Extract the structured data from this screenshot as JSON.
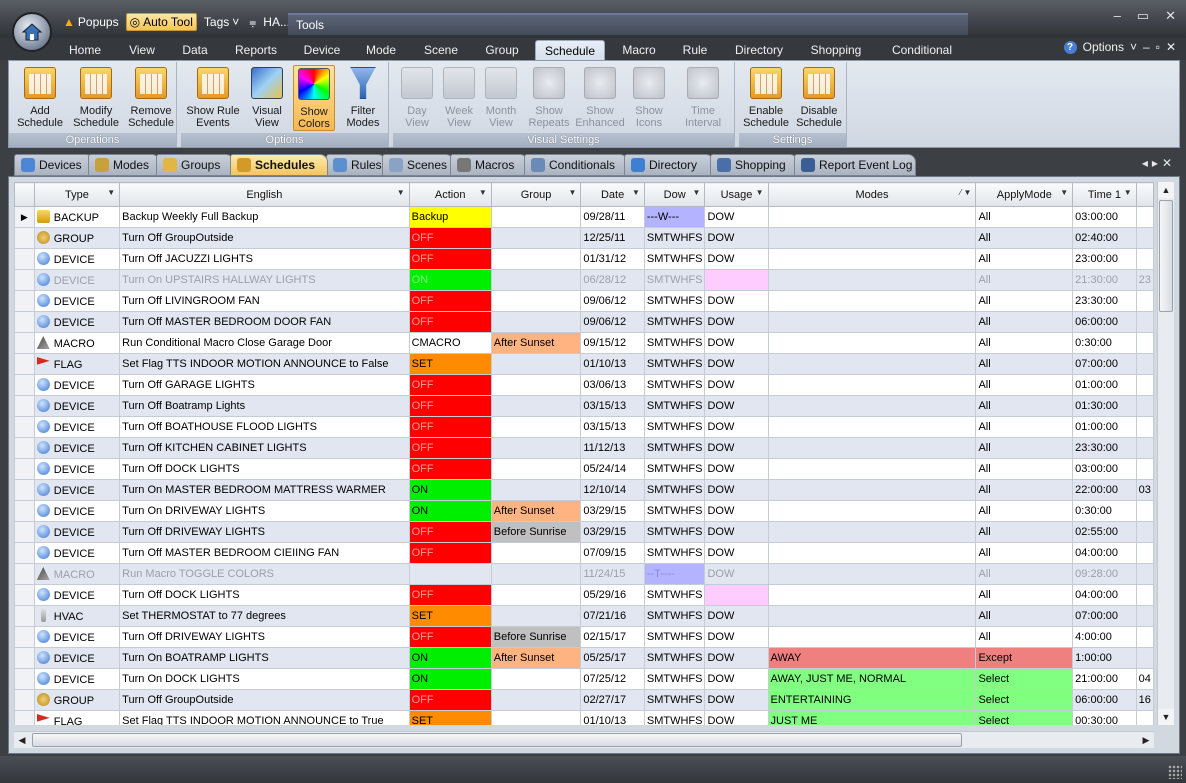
{
  "qat": {
    "popups": "Popups",
    "auto_tool": "Auto Tool",
    "tags": "Tags",
    "app_title": "HA..."
  },
  "context_tab": "Tools",
  "window_controls": {
    "minimize": "–",
    "restore": "▭",
    "close": "✕"
  },
  "ribbon_tabs": [
    "Home",
    "View",
    "Data",
    "Reports",
    "Device",
    "Mode",
    "Scene",
    "Group",
    "Schedule",
    "Macro",
    "Rule",
    "Directory",
    "Shopping",
    "Conditional"
  ],
  "active_ribbon_tab": "Schedule",
  "options_label": "Options",
  "ribbon": {
    "operations": {
      "label": "Operations",
      "add": "Add Schedule",
      "modify": "Modify Schedule",
      "remove": "Remove Schedule"
    },
    "options": {
      "label": "Options",
      "show_rule_events": "Show Rule Events",
      "visual_view": "Visual View",
      "show_colors": "Show Colors",
      "filter_modes": "Filter Modes"
    },
    "visual_settings": {
      "label": "Visual Settings",
      "day_view": "Day View",
      "week_view": "Week View",
      "month_view": "Month View",
      "show_repeats": "Show Repeats",
      "show_enhanced": "Show Enhanced",
      "show_icons": "Show Icons",
      "time_interval": "Time Interval"
    },
    "settings": {
      "label": "Settings",
      "enable": "Enable Schedule",
      "disable": "Disable Schedule"
    }
  },
  "doc_tabs": [
    "Devices",
    "Modes",
    "Groups",
    "Schedules",
    "Rules",
    "Scenes",
    "Macros",
    "Conditionals",
    "Directory",
    "Shopping",
    "Report Event Log"
  ],
  "active_doc_tab": "Schedules",
  "columns": [
    "Type",
    "English",
    "Action",
    "Group",
    "Date",
    "Dow",
    "Usage",
    "Modes",
    "ApplyMode",
    "Time 1"
  ],
  "rows": [
    {
      "type": "BACKUP",
      "icon": "backup-icon",
      "english": "Backup Weekly Full Backup",
      "action": "Backup",
      "action_color": "yellow",
      "group": "",
      "group_color": "",
      "date": "09/28/11",
      "dow": "---W---",
      "dow_color": "lavender",
      "usage": "DOW",
      "usage_color": "",
      "modes": "",
      "modes_color": "",
      "apply": "All",
      "apply_color": "",
      "time1": "03:00:00",
      "extra": "",
      "dim": false,
      "current": true
    },
    {
      "type": "GROUP",
      "icon": "group-icon",
      "english": "Turn Off GroupOutside",
      "action": "OFF",
      "action_color": "red",
      "group": "",
      "group_color": "",
      "date": "12/25/11",
      "dow": "SMTWHFS",
      "dow_color": "",
      "usage": "DOW",
      "usage_color": "",
      "modes": "",
      "modes_color": "",
      "apply": "All",
      "apply_color": "",
      "time1": "02:40:00",
      "extra": "",
      "dim": false,
      "current": false
    },
    {
      "type": "DEVICE",
      "icon": "device-icon",
      "english": "Turn Off JACUZZI LIGHTS",
      "action": "OFF",
      "action_color": "red",
      "group": "",
      "group_color": "",
      "date": "01/31/12",
      "dow": "SMTWHFS",
      "dow_color": "",
      "usage": "DOW",
      "usage_color": "",
      "modes": "",
      "modes_color": "",
      "apply": "All",
      "apply_color": "",
      "time1": "23:00:00",
      "extra": "",
      "dim": false,
      "current": false
    },
    {
      "type": "DEVICE",
      "icon": "device-icon",
      "english": "Turn On UPSTAIRS HALLWAY LIGHTS",
      "action": "ON",
      "action_color": "green",
      "group": "",
      "group_color": "",
      "date": "06/28/12",
      "dow": "SMTWHFS",
      "dow_color": "",
      "usage": "",
      "usage_color": "pink",
      "modes": "",
      "modes_color": "",
      "apply": "All",
      "apply_color": "",
      "time1": "21:30:00",
      "extra": "23",
      "dim": true,
      "current": false
    },
    {
      "type": "DEVICE",
      "icon": "device-icon",
      "english": "Turn Off LIVINGROOM FAN",
      "action": "OFF",
      "action_color": "red",
      "group": "",
      "group_color": "",
      "date": "09/06/12",
      "dow": "SMTWHFS",
      "dow_color": "",
      "usage": "DOW",
      "usage_color": "",
      "modes": "",
      "modes_color": "",
      "apply": "All",
      "apply_color": "",
      "time1": "23:30:00",
      "extra": "",
      "dim": false,
      "current": false
    },
    {
      "type": "DEVICE",
      "icon": "device-icon",
      "english": "Turn Off MASTER BEDROOM DOOR FAN",
      "action": "OFF",
      "action_color": "red",
      "group": "",
      "group_color": "",
      "date": "09/06/12",
      "dow": "SMTWHFS",
      "dow_color": "",
      "usage": "DOW",
      "usage_color": "",
      "modes": "",
      "modes_color": "",
      "apply": "All",
      "apply_color": "",
      "time1": "06:00:00",
      "extra": "",
      "dim": false,
      "current": false
    },
    {
      "type": "MACRO",
      "icon": "macro-icon",
      "english": "Run Conditional Macro Close Garage Door",
      "action": "CMACRO",
      "action_color": "",
      "group": "After Sunset",
      "group_color": "peach",
      "date": "09/15/12",
      "dow": "SMTWHFS",
      "dow_color": "",
      "usage": "DOW",
      "usage_color": "",
      "modes": "",
      "modes_color": "",
      "apply": "All",
      "apply_color": "",
      "time1": "0:30:00",
      "extra": "",
      "dim": false,
      "current": false
    },
    {
      "type": "FLAG",
      "icon": "flag-icon",
      "english": "Set Flag TTS INDOOR MOTION ANNOUNCE to False",
      "action": "SET",
      "action_color": "orange",
      "group": "",
      "group_color": "",
      "date": "01/10/13",
      "dow": "SMTWHFS",
      "dow_color": "",
      "usage": "DOW",
      "usage_color": "",
      "modes": "",
      "modes_color": "",
      "apply": "All",
      "apply_color": "",
      "time1": "07:00:00",
      "extra": "",
      "dim": false,
      "current": false
    },
    {
      "type": "DEVICE",
      "icon": "device-icon",
      "english": "Turn Off GARAGE LIGHTS",
      "action": "OFF",
      "action_color": "red",
      "group": "",
      "group_color": "",
      "date": "03/06/13",
      "dow": "SMTWHFS",
      "dow_color": "",
      "usage": "DOW",
      "usage_color": "",
      "modes": "",
      "modes_color": "",
      "apply": "All",
      "apply_color": "",
      "time1": "01:00:00",
      "extra": "",
      "dim": false,
      "current": false
    },
    {
      "type": "DEVICE",
      "icon": "device-icon",
      "english": "Turn Off Boatramp Lights",
      "action": "OFF",
      "action_color": "red",
      "group": "",
      "group_color": "",
      "date": "03/15/13",
      "dow": "SMTWHFS",
      "dow_color": "",
      "usage": "DOW",
      "usage_color": "",
      "modes": "",
      "modes_color": "",
      "apply": "All",
      "apply_color": "",
      "time1": "01:30:00",
      "extra": "",
      "dim": false,
      "current": false
    },
    {
      "type": "DEVICE",
      "icon": "device-icon",
      "english": "Turn Off BOATHOUSE FLOOD LIGHTS",
      "action": "OFF",
      "action_color": "red",
      "group": "",
      "group_color": "",
      "date": "03/15/13",
      "dow": "SMTWHFS",
      "dow_color": "",
      "usage": "DOW",
      "usage_color": "",
      "modes": "",
      "modes_color": "",
      "apply": "All",
      "apply_color": "",
      "time1": "01:00:00",
      "extra": "",
      "dim": false,
      "current": false
    },
    {
      "type": "DEVICE",
      "icon": "device-icon",
      "english": "Turn Off KITCHEN CABINET LIGHTS",
      "action": "OFF",
      "action_color": "red",
      "group": "",
      "group_color": "",
      "date": "11/12/13",
      "dow": "SMTWHFS",
      "dow_color": "",
      "usage": "DOW",
      "usage_color": "",
      "modes": "",
      "modes_color": "",
      "apply": "All",
      "apply_color": "",
      "time1": "23:30:00",
      "extra": "",
      "dim": false,
      "current": false
    },
    {
      "type": "DEVICE",
      "icon": "device-icon",
      "english": "Turn Off DOCK LIGHTS",
      "action": "OFF",
      "action_color": "red",
      "group": "",
      "group_color": "",
      "date": "05/24/14",
      "dow": "SMTWHFS",
      "dow_color": "",
      "usage": "DOW",
      "usage_color": "",
      "modes": "",
      "modes_color": "",
      "apply": "All",
      "apply_color": "",
      "time1": "03:00:00",
      "extra": "",
      "dim": false,
      "current": false
    },
    {
      "type": "DEVICE",
      "icon": "device-icon",
      "english": "Turn On MASTER BEDROOM MATTRESS WARMER",
      "action": "ON",
      "action_color": "green",
      "group": "",
      "group_color": "",
      "date": "12/10/14",
      "dow": "SMTWHFS",
      "dow_color": "",
      "usage": "DOW",
      "usage_color": "",
      "modes": "",
      "modes_color": "",
      "apply": "All",
      "apply_color": "",
      "time1": "22:00:00",
      "extra": "03",
      "dim": false,
      "current": false
    },
    {
      "type": "DEVICE",
      "icon": "device-icon",
      "english": "Turn On DRIVEWAY LIGHTS",
      "action": "ON",
      "action_color": "green",
      "group": "After Sunset",
      "group_color": "peach",
      "date": "03/29/15",
      "dow": "SMTWHFS",
      "dow_color": "",
      "usage": "DOW",
      "usage_color": "",
      "modes": "",
      "modes_color": "",
      "apply": "All",
      "apply_color": "",
      "time1": "0:30:00",
      "extra": "",
      "dim": false,
      "current": false
    },
    {
      "type": "DEVICE",
      "icon": "device-icon",
      "english": "Turn Off DRIVEWAY LIGHTS",
      "action": "OFF",
      "action_color": "red",
      "group": "Before Sunrise",
      "group_color": "lightgray",
      "date": "03/29/15",
      "dow": "SMTWHFS",
      "dow_color": "",
      "usage": "DOW",
      "usage_color": "",
      "modes": "",
      "modes_color": "",
      "apply": "All",
      "apply_color": "",
      "time1": "02:55:00",
      "extra": "",
      "dim": false,
      "current": false
    },
    {
      "type": "DEVICE",
      "icon": "device-icon",
      "english": "Turn Off MASTER BEDROOM CIEIING FAN",
      "action": "OFF",
      "action_color": "red",
      "group": "",
      "group_color": "",
      "date": "07/09/15",
      "dow": "SMTWHFS",
      "dow_color": "",
      "usage": "DOW",
      "usage_color": "",
      "modes": "",
      "modes_color": "",
      "apply": "All",
      "apply_color": "",
      "time1": "04:00:00",
      "extra": "",
      "dim": false,
      "current": false
    },
    {
      "type": "MACRO",
      "icon": "macro-icon",
      "english": "Run Macro TOGGLE COLORS",
      "action": "",
      "action_color": "",
      "group": "",
      "group_color": "",
      "date": "11/24/15",
      "dow": "--T----",
      "dow_color": "lavender",
      "usage": "DOW",
      "usage_color": "",
      "modes": "",
      "modes_color": "",
      "apply": "All",
      "apply_color": "",
      "time1": "09:28:00",
      "extra": "",
      "dim": true,
      "current": false
    },
    {
      "type": "DEVICE",
      "icon": "device-icon",
      "english": "Turn Off DOCK LIGHTS",
      "action": "OFF",
      "action_color": "red",
      "group": "",
      "group_color": "",
      "date": "05/29/16",
      "dow": "SMTWHFS",
      "dow_color": "",
      "usage": "",
      "usage_color": "pink",
      "modes": "",
      "modes_color": "",
      "apply": "All",
      "apply_color": "",
      "time1": "04:00:00",
      "extra": "",
      "dim": false,
      "current": false
    },
    {
      "type": "HVAC",
      "icon": "hvac-icon",
      "english": "Set THERMOSTAT to 77 degrees",
      "action": "SET",
      "action_color": "orange",
      "group": "",
      "group_color": "",
      "date": "07/21/16",
      "dow": "SMTWHFS",
      "dow_color": "",
      "usage": "DOW",
      "usage_color": "",
      "modes": "",
      "modes_color": "",
      "apply": "All",
      "apply_color": "",
      "time1": "07:00:00",
      "extra": "",
      "dim": false,
      "current": false
    },
    {
      "type": "DEVICE",
      "icon": "device-icon",
      "english": "Turn Off DRIVEWAY LIGHTS",
      "action": "OFF",
      "action_color": "red",
      "group": "Before Sunrise",
      "group_color": "lightgray",
      "date": "02/15/17",
      "dow": "SMTWHFS",
      "dow_color": "",
      "usage": "DOW",
      "usage_color": "",
      "modes": "",
      "modes_color": "",
      "apply": "All",
      "apply_color": "",
      "time1": "4:00:00",
      "extra": "",
      "dim": false,
      "current": false
    },
    {
      "type": "DEVICE",
      "icon": "device-icon",
      "english": "Turn On BOATRAMP LIGHTS",
      "action": "ON",
      "action_color": "green",
      "group": "After Sunset",
      "group_color": "peach",
      "date": "05/25/17",
      "dow": "SMTWHFS",
      "dow_color": "",
      "usage": "DOW",
      "usage_color": "",
      "modes": "AWAY",
      "modes_color": "salmon",
      "apply": "Except",
      "apply_color": "salmon",
      "time1": "1:00:00",
      "extra": "",
      "dim": false,
      "current": false
    },
    {
      "type": "DEVICE",
      "icon": "device-icon",
      "english": "Turn On DOCK LIGHTS",
      "action": "ON",
      "action_color": "green",
      "group": "",
      "group_color": "",
      "date": "07/25/12",
      "dow": "SMTWHFS",
      "dow_color": "",
      "usage": "DOW",
      "usage_color": "",
      "modes": "AWAY, JUST ME, NORMAL",
      "modes_color": "lightgreen",
      "apply": "Select",
      "apply_color": "lightgreen",
      "time1": "21:00:00",
      "extra": "04",
      "dim": false,
      "current": false
    },
    {
      "type": "GROUP",
      "icon": "group-icon",
      "english": "Turn Off GroupOutside",
      "action": "OFF",
      "action_color": "red",
      "group": "",
      "group_color": "",
      "date": "02/27/17",
      "dow": "SMTWHFS",
      "dow_color": "",
      "usage": "DOW",
      "usage_color": "",
      "modes": "ENTERTAINING",
      "modes_color": "lightgreen",
      "apply": "Select",
      "apply_color": "lightgreen",
      "time1": "06:00:00",
      "extra": "16",
      "dim": false,
      "current": false
    },
    {
      "type": "FLAG",
      "icon": "flag-icon",
      "english": "Set Flag TTS INDOOR MOTION ANNOUNCE to True",
      "action": "SET",
      "action_color": "orange",
      "group": "",
      "group_color": "",
      "date": "01/10/13",
      "dow": "SMTWHFS",
      "dow_color": "",
      "usage": "DOW",
      "usage_color": "",
      "modes": "JUST ME",
      "modes_color": "lightgreen",
      "apply": "Select",
      "apply_color": "lightgreen",
      "time1": "00:30:00",
      "extra": "",
      "dim": false,
      "current": false
    }
  ]
}
